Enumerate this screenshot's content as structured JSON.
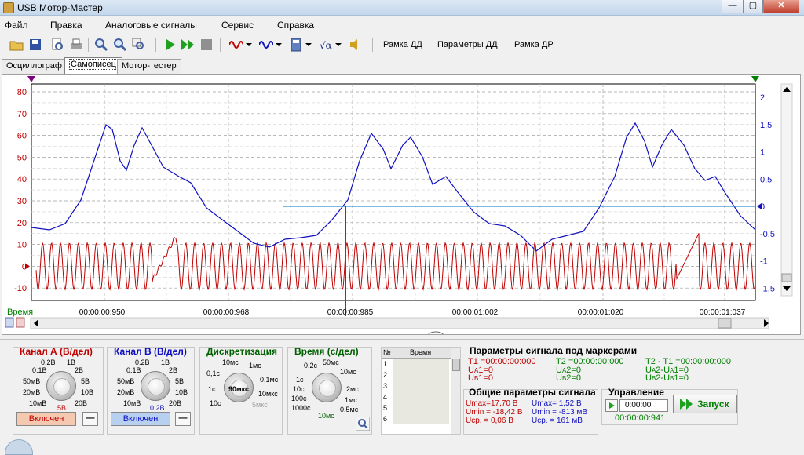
{
  "window": {
    "title": "USB Мотор-Мастер",
    "min": "—",
    "max": "▢",
    "close": "✕"
  },
  "menu": [
    "Файл",
    "Правка",
    "Аналоговые сигналы",
    "Сервис",
    "Справка"
  ],
  "toolbar": {
    "frame_dd": "Рамка ДД",
    "params_dd": "Параметры ДД",
    "frame_dr": "Рамка ДР"
  },
  "tabs": [
    "Осциллограф",
    "Самописец",
    "Мотор-тестер"
  ],
  "plot": {
    "left_ticks": [
      "80",
      "70",
      "60",
      "50",
      "40",
      "30",
      "20",
      "10",
      "0",
      "-10"
    ],
    "right_ticks": [
      "2",
      "1,5",
      "1",
      "0,5",
      "0",
      "-0,5",
      "-1",
      "-1,5"
    ],
    "time_label": "Время",
    "time_ticks": [
      "00:00:00:950",
      "00:00:00:968",
      "00:00:00:985",
      "00:00:01:002",
      "00:00:01:020",
      "00:00:01:037"
    ],
    "colors": {
      "channel_a": "#c00000",
      "channel_b": "#1010c0",
      "marker": "#008000",
      "grid": "#a0a0a0"
    }
  },
  "chan_a": {
    "title": "Канал А (В/дел)",
    "labels": [
      "0.2В",
      "1В",
      "0.1В",
      "2В",
      "50мВ",
      "5В",
      "20мВ",
      "10В",
      "10мВ",
      "20В"
    ],
    "value": "5В",
    "button": "Включен"
  },
  "chan_b": {
    "title": "Канал В (В/дел)",
    "labels": [
      "0.2В",
      "1В",
      "0.1В",
      "2В",
      "50мВ",
      "5В",
      "20мВ",
      "10В",
      "10мВ",
      "20В"
    ],
    "value": "0.2В",
    "button": "Включен"
  },
  "disc": {
    "title": "Дискретизация",
    "labels": [
      "10мс",
      "1мс",
      "0,1с",
      "0,1мс",
      "1с",
      "10мкс",
      "10с",
      "5мкс"
    ],
    "value": "90мкс"
  },
  "time": {
    "title": "Время (с/дел)",
    "labels": [
      "0.2с",
      "50мс",
      "1с",
      "10мс",
      "10с",
      "2мс",
      "100с",
      "1мс",
      "1000с",
      "0.5мс"
    ],
    "value": "10мс"
  },
  "table": {
    "col_no": "№",
    "col_time": "Время",
    "rows": [
      "1",
      "2",
      "3",
      "4",
      "5",
      "6"
    ]
  },
  "markers": {
    "title": "Параметры сигнала под маркерами",
    "t1": "T1 =00:00:00:000",
    "t2": "T2 =00:00:00:000",
    "t2t1": "T2 - T1 =00:00:00:000",
    "ua1": "U",
    "ua1_sub": "A",
    "ua1_rest": "1=0",
    "ub1": "U",
    "ub1_sub": "B",
    "ub1_rest": "1=0",
    "ua2": "U",
    "ua2_sub": "A",
    "ua2_rest": "2=0",
    "ub2": "U",
    "ub2_sub": "B",
    "ub2_rest": "2=0",
    "dua": "U",
    "dua_sub": "A",
    "dua_rest": "2-U",
    "dua_sub2": "A",
    "dua_rest2": "1=0",
    "dub": "U",
    "dub_sub": "B",
    "dub_rest": "2-U",
    "dub_sub2": "B",
    "dub_rest2": "1=0"
  },
  "general": {
    "title": "Общие параметры сигнала",
    "a_max": "Umax=17,70 В",
    "a_min": "Umin = -18,42 В",
    "a_avg": "Uср. = 0,06 В",
    "b_max": "Umax= 1,52 В",
    "b_min": "Umin = -813 мВ",
    "b_avg": "Uср. = 161 мВ"
  },
  "control": {
    "title": "Управление",
    "time_value": "0:00:00",
    "elapsed": "00:00:00:941",
    "start": "Запуск"
  }
}
